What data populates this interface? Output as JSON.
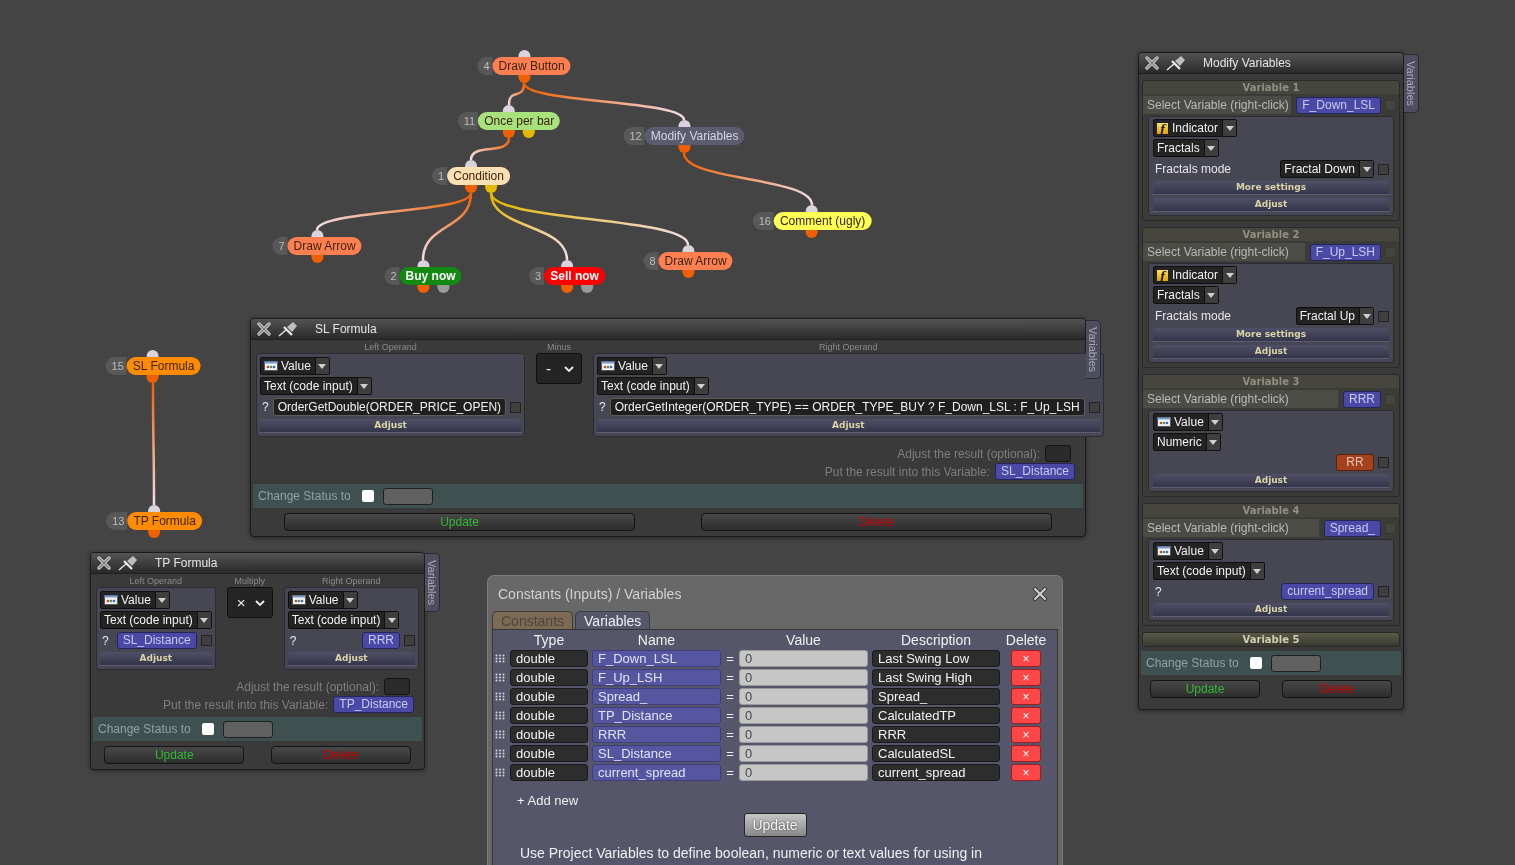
{
  "graph": {
    "nodes": [
      {
        "number": "4",
        "label": "Draw Button",
        "color": "#ff7f50",
        "ports": [
          {
            "color": "#f06000",
            "children": [
              {
                "number": "11",
                "label": "Once per bar",
                "color": "#a8e27c",
                "ports": [
                  {
                    "color": "#f06000",
                    "children": [
                      {
                        "number": "1",
                        "label": "Condition",
                        "color": "#ffe0b2",
                        "ports": [
                          {
                            "color": "#f06000",
                            "children": [
                              {
                                "number": "7",
                                "label": "Draw Arrow",
                                "color": "#ff7f50",
                                "ports": [
                                  {
                                    "color": "#f06000"
                                  }
                                ]
                              },
                              {
                                "number": "2",
                                "label": "Buy now",
                                "color": "#128a12",
                                "ports": [
                                  {
                                    "color": "#f06000"
                                  },
                                  {
                                    "color": "#9a9a9a"
                                  }
                                ]
                              }
                            ]
                          },
                          {
                            "color": "#e6b800",
                            "children": [
                              {
                                "number": "3",
                                "label": "Sell now",
                                "color": "#ff0000",
                                "ports": [
                                  {
                                    "color": "#f06000"
                                  },
                                  {
                                    "color": "#9a9a9a"
                                  }
                                ]
                              },
                              {
                                "number": "8",
                                "label": "Draw Arrow",
                                "color": "#ff7f50",
                                "ports": [
                                  {
                                    "color": "#f06000"
                                  }
                                ]
                              }
                            ]
                          }
                        ]
                      }
                    ]
                  },
                  {
                    "color": "#e6b800"
                  }
                ]
              },
              {
                "number": "12",
                "label": "Modify Variables",
                "color": "#5c5c70",
                "ports": [
                  {
                    "color": "#f06000",
                    "children": [
                      {
                        "number": "16",
                        "label": "Comment (ugly)",
                        "color": "#ffff55",
                        "ports": [
                          {
                            "color": "#f06000"
                          }
                        ]
                      }
                    ]
                  }
                ]
              }
            ]
          }
        ]
      },
      {
        "number": "15",
        "label": "SL Formula",
        "color": "#ff8c00",
        "ports": [
          {
            "color": "#f06000",
            "children": [
              {
                "number": "13",
                "label": "TP Formula",
                "color": "#ff8c00",
                "ports": [
                  {
                    "color": "#f06000"
                  }
                ]
              }
            ]
          }
        ]
      }
    ]
  },
  "formula_windows": [
    {
      "title": "SL Formula",
      "side_tab": "Variables",
      "left_operand": {
        "heading": "Left Operand",
        "source": {
          "kind": "value",
          "label": "Value"
        },
        "type": "Text (code input)",
        "rows": [
          {
            "kind": "code",
            "prefix": "?",
            "value": "OrderGetDouble(ORDER_PRICE_OPEN)",
            "checked": false
          }
        ],
        "buttons": [
          "Adjust"
        ]
      },
      "operator": {
        "heading": "Minus",
        "symbol": "-"
      },
      "right_operand": {
        "heading": "Right Operand",
        "source": {
          "kind": "value",
          "label": "Value"
        },
        "type": "Text (code input)",
        "rows": [
          {
            "kind": "code",
            "prefix": "?",
            "value": "OrderGetInteger(ORDER_TYPE) == ORDER_TYPE_BUY ? F_Down_LSL : F_Up_LSH",
            "checked": false
          }
        ],
        "buttons": [
          "Adjust"
        ]
      },
      "adjust_result": {
        "label": "Adjust the result (optional):"
      },
      "result_variable": {
        "label": "Put the result into this Variable:",
        "value": "SL_Distance"
      },
      "change_status": {
        "label": "Change Status to",
        "checked": false
      },
      "buttons": [
        {
          "kind": "update",
          "label": "Update"
        },
        {
          "kind": "delete",
          "label": "Delete"
        }
      ]
    },
    {
      "title": "TP Formula",
      "side_tab": "Variables",
      "left_operand": {
        "heading": "Left Operand",
        "source": {
          "kind": "value",
          "label": "Value"
        },
        "type": "Text (code input)",
        "rows": [
          {
            "kind": "variable",
            "prefix": "?",
            "value": "SL_Distance",
            "checked": false
          }
        ],
        "buttons": [
          "Adjust"
        ]
      },
      "operator": {
        "heading": "Multiply",
        "symbol": "×"
      },
      "right_operand": {
        "heading": "Right Operand",
        "source": {
          "kind": "value",
          "label": "Value"
        },
        "type": "Text (code input)",
        "rows": [
          {
            "kind": "variable",
            "prefix": "?",
            "value": "RRR",
            "checked": false
          }
        ],
        "buttons": [
          "Adjust"
        ]
      },
      "adjust_result": {
        "label": "Adjust the result (optional):"
      },
      "result_variable": {
        "label": "Put the result into this Variable:",
        "value": "TP_Distance"
      },
      "change_status": {
        "label": "Change Status to",
        "checked": false
      },
      "buttons": [
        {
          "kind": "update",
          "label": "Update"
        },
        {
          "kind": "delete",
          "label": "Delete"
        }
      ]
    }
  ],
  "modify_window": {
    "title": "Modify Variables",
    "side_tab": "Variables",
    "variables": [
      {
        "heading": "Variable 1",
        "expanded": true,
        "select_label": "Select Variable (right-click)",
        "variable": "F_Down_LSL",
        "checked": false,
        "source": {
          "kind": "indicator",
          "icon": "f",
          "label": "Indicator"
        },
        "type": "Fractals",
        "rows": [
          {
            "kind": "dropdown",
            "label": "Fractals mode",
            "value": "Fractal Down",
            "checked": false
          }
        ],
        "buttons": [
          "More settings",
          "Adjust"
        ]
      },
      {
        "heading": "Variable 2",
        "expanded": true,
        "select_label": "Select Variable (right-click)",
        "variable": "F_Up_LSH",
        "checked": false,
        "source": {
          "kind": "indicator",
          "icon": "f",
          "label": "Indicator"
        },
        "type": "Fractals",
        "rows": [
          {
            "kind": "dropdown",
            "label": "Fractals mode",
            "value": "Fractal Up",
            "checked": false
          }
        ],
        "buttons": [
          "More settings",
          "Adjust"
        ]
      },
      {
        "heading": "Variable 3",
        "expanded": true,
        "select_label": "Select Variable (right-click)",
        "variable": "RRR",
        "checked": false,
        "source": {
          "kind": "value",
          "label": "Value"
        },
        "type": "Numeric",
        "rows": [
          {
            "kind": "constant",
            "value": "RR",
            "checked": false
          }
        ],
        "buttons": [
          "Adjust"
        ]
      },
      {
        "heading": "Variable 4",
        "expanded": true,
        "select_label": "Select Variable (right-click)",
        "variable": "Spread_",
        "checked": false,
        "source": {
          "kind": "value",
          "label": "Value"
        },
        "type": "Text (code input)",
        "rows": [
          {
            "kind": "variable",
            "prefix": "?",
            "value": "current_spread",
            "checked": false
          }
        ],
        "buttons": [
          "Adjust"
        ]
      },
      {
        "heading": "Variable 5",
        "expanded": false
      }
    ],
    "change_status": {
      "label": "Change Status to",
      "checked": false
    },
    "buttons": [
      {
        "kind": "update",
        "label": "Update"
      },
      {
        "kind": "delete",
        "label": "Delete"
      }
    ]
  },
  "constants_window": {
    "title": "Constants (Inputs) / Variables",
    "tabs": [
      {
        "label": "Constants",
        "selected": false
      },
      {
        "label": "Variables",
        "selected": true
      }
    ],
    "columns": [
      "Type",
      "Name",
      "Value",
      "Description",
      "Delete"
    ],
    "rows": [
      {
        "type": "double",
        "name": "F_Down_LSL",
        "sign": "=",
        "value": "0",
        "description": "Last Swing Low",
        "delete": "×"
      },
      {
        "type": "double",
        "name": "F_Up_LSH",
        "sign": "=",
        "value": "0",
        "description": "Last Swing High",
        "delete": "×"
      },
      {
        "type": "double",
        "name": "Spread_",
        "sign": "=",
        "value": "0",
        "description": "Spread_",
        "delete": "×"
      },
      {
        "type": "double",
        "name": "TP_Distance",
        "sign": "=",
        "value": "0",
        "description": "CalculatedTP",
        "delete": "×"
      },
      {
        "type": "double",
        "name": "RRR",
        "sign": "=",
        "value": "0",
        "description": "RRR",
        "delete": "×"
      },
      {
        "type": "double",
        "name": "SL_Distance",
        "sign": "=",
        "value": "0",
        "description": "CalculatedSL",
        "delete": "×"
      },
      {
        "type": "double",
        "name": "current_spread",
        "sign": "=",
        "value": "0",
        "description": "current_spread",
        "delete": "×"
      }
    ],
    "add_new": "+ Add new",
    "update": "Update",
    "help": "Use Project Variables to define boolean, numeric or text values for using in"
  }
}
